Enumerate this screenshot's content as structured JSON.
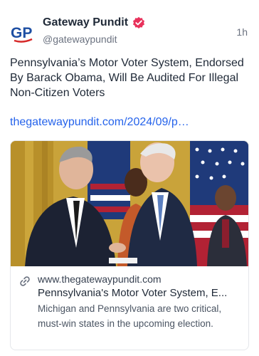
{
  "post": {
    "author": {
      "name": "Gateway Pundit",
      "handle": "@gatewaypundit",
      "avatar_text": "GP",
      "verified": true
    },
    "time": "1h",
    "text": "Pennsylvania’s Motor Voter System, Endorsed By Barack Obama, Will Be Audited For Illegal Non-Citizen Voters",
    "link": "thegatewaypundit.com/2024/09/p…"
  },
  "card": {
    "domain": "www.thegatewaypundit.com",
    "title": "Pennsylvania's Motor Voter System, E...",
    "description": "Michigan and Pennsylvania are two critical, must-win states in the upcoming election.",
    "image_alt": "photo"
  },
  "colors": {
    "avatar_blue": "#1e4fa3",
    "avatar_red": "#d62828",
    "verified": "#e8315b",
    "link": "#2563eb"
  }
}
